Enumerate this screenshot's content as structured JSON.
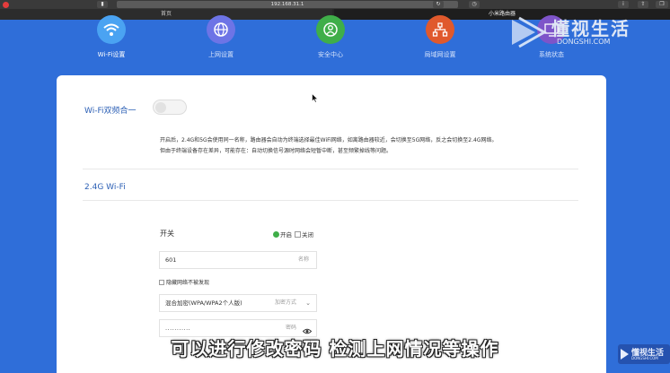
{
  "browser": {
    "address": "192.168.31.1",
    "tabs": [
      {
        "label": "首页"
      },
      {
        "label": "小米路由器"
      }
    ]
  },
  "nav": {
    "items": [
      {
        "label": "Wi-Fi设置",
        "icon": "wifi-icon",
        "color": "#4aa3f2"
      },
      {
        "label": "上网设置",
        "icon": "globe-icon",
        "color": "#6d74e6"
      },
      {
        "label": "安全中心",
        "icon": "shield-icon",
        "color": "#3fae49"
      },
      {
        "label": "局域网设置",
        "icon": "network-icon",
        "color": "#e0592c"
      },
      {
        "label": "系统状态",
        "icon": "status-icon",
        "color": "#7e54c9"
      }
    ]
  },
  "dual_band": {
    "title": "Wi-Fi双频合一",
    "enabled": false,
    "description_line1": "开启后，2.4G和5G会使用同一名称，路由器会自动为终端选择最佳WiFi网络，如离路由器较近，会切换至5G网络，反之会切换至2.4G网络。",
    "description_line2": "但由于终端设备存在差异，可能存在：自动切换信号源时网络会短暂中断，甚至频繁掉线等问题。"
  },
  "wifi24": {
    "title": "2.4G Wi-Fi",
    "switch_label": "开关",
    "on_label": "开启",
    "off_label": "关闭",
    "name_value": "601",
    "name_hint": "名称",
    "hide_label": "隐藏网络不被发现",
    "encryption_value": "混合加密(WPA/WPA2个人版)",
    "encryption_hint": "加密方式",
    "password_value": "...........",
    "password_hint": "密码"
  },
  "overlay": {
    "subtitle": "可以进行修改密码 检测上网情况等操作",
    "watermark": "懂视生活",
    "watermark_sub": "DONGSHI.COM"
  }
}
